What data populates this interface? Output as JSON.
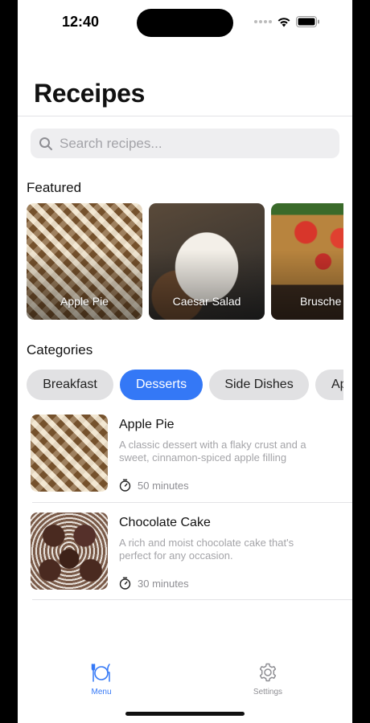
{
  "status_bar": {
    "time": "12:40"
  },
  "header": {
    "title": "Receipes"
  },
  "search": {
    "placeholder": "Search recipes..."
  },
  "featured": {
    "title": "Featured",
    "items": [
      {
        "label": "Apple Pie"
      },
      {
        "label": "Caesar Salad"
      },
      {
        "label": "Brusche"
      }
    ]
  },
  "categories": {
    "title": "Categories",
    "items": [
      {
        "label": "Breakfast",
        "selected": false
      },
      {
        "label": "Desserts",
        "selected": true
      },
      {
        "label": "Side Dishes",
        "selected": false
      },
      {
        "label": "Ap",
        "selected": false
      }
    ]
  },
  "recipes": [
    {
      "title": "Apple Pie",
      "description": "A classic dessert with a flaky crust and a sweet, cinnamon-spiced apple filling",
      "time": "50 minutes"
    },
    {
      "title": "Chocolate Cake",
      "description": "A rich and moist chocolate cake that's perfect for any occasion.",
      "time": "30 minutes"
    }
  ],
  "tab_bar": {
    "items": [
      {
        "label": "Menu",
        "icon": "fork-knife-icon",
        "active": true
      },
      {
        "label": "Settings",
        "icon": "gear-icon",
        "active": false
      }
    ]
  },
  "colors": {
    "accent": "#3478f6",
    "inactive": "#8e8e93"
  }
}
